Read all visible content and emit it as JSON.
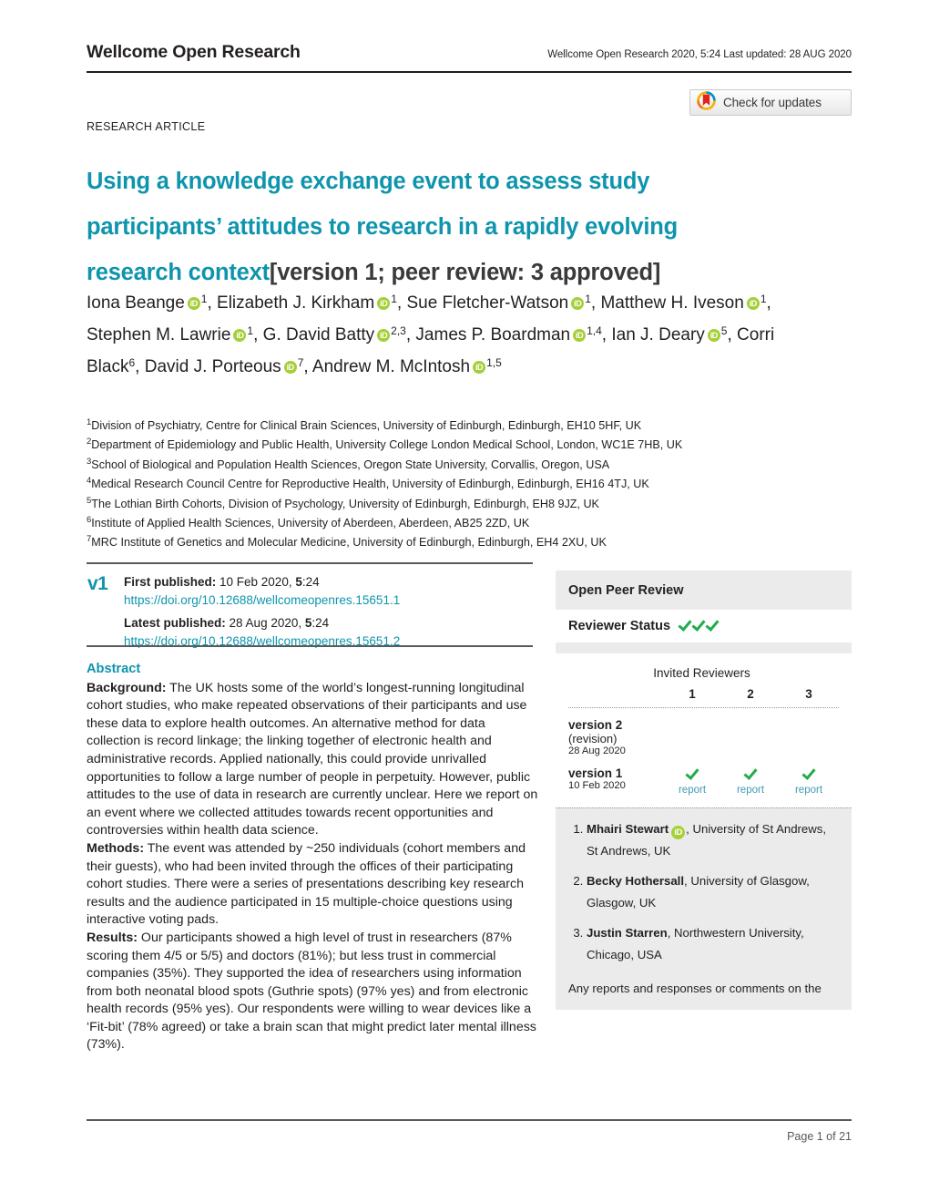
{
  "running_head": {
    "journal": "Wellcome Open Research",
    "citation": "Wellcome Open Research 2020, 5:24 Last updated: 28 AUG 2020"
  },
  "crossmark": {
    "label": "Check for updates",
    "icon": "crossmark-icon"
  },
  "article": {
    "type": "RESEARCH ARTICLE",
    "title_main": "Using a knowledge exchange event to assess study participants’ attitudes to research in a rapidly evolving research context",
    "title_version": "[version 1; peer review: 3 approved]",
    "title_color": "#0e95ad"
  },
  "authors": [
    {
      "name": "Iona Beange",
      "orcid": true,
      "affil": "1",
      "sep": ", "
    },
    {
      "name": "Elizabeth J. Kirkham",
      "orcid": true,
      "affil": "1",
      "sep": ", "
    },
    {
      "name": "Sue Fletcher-Watson",
      "orcid": true,
      "affil": "1",
      "sep": ", "
    },
    {
      "name": "Matthew H. Iveson",
      "orcid": true,
      "affil": "1",
      "sep": ", "
    },
    {
      "name": "Stephen M. Lawrie",
      "orcid": true,
      "affil": "1",
      "sep": ", "
    },
    {
      "name": "G. David Batty",
      "orcid": true,
      "affil": "2,3",
      "sep": ", "
    },
    {
      "name": "James P. Boardman",
      "orcid": true,
      "affil": "1,4",
      "sep": ", "
    },
    {
      "name": "Ian J. Deary",
      "orcid": true,
      "affil": "5",
      "sep": ", "
    },
    {
      "name": "Corri Black",
      "orcid": false,
      "affil": "6",
      "sep": ", "
    },
    {
      "name": "David J. Porteous",
      "orcid": true,
      "affil": "7",
      "sep": ", "
    },
    {
      "name": "Andrew M. McIntosh",
      "orcid": true,
      "affil": "1,5",
      "sep": ""
    }
  ],
  "affiliations": [
    {
      "num": "1",
      "text": "Division of Psychiatry, Centre for Clinical Brain Sciences, University of Edinburgh, Edinburgh, EH10 5HF, UK"
    },
    {
      "num": "2",
      "text": "Department of Epidemiology and Public Health, University College London Medical School, London, WC1E 7HB, UK"
    },
    {
      "num": "3",
      "text": "School of Biological and Population Health Sciences, Oregon State University, Corvallis, Oregon, USA"
    },
    {
      "num": "4",
      "text": "Medical Research Council Centre for Reproductive Health, University of Edinburgh, Edinburgh, EH16 4TJ, UK"
    },
    {
      "num": "5",
      "text": "The Lothian Birth Cohorts, Division of Psychology, University of Edinburgh, Edinburgh, EH8 9JZ, UK"
    },
    {
      "num": "6",
      "text": "Institute of Applied Health Sciences, University of Aberdeen, Aberdeen, AB25 2ZD, UK"
    },
    {
      "num": "7",
      "text": "MRC Institute of Genetics and Molecular Medicine, University of Edinburgh, Edinburgh, EH4 2XU, UK"
    }
  ],
  "publication": {
    "version_tag": "v1",
    "first_published_label": "First published:",
    "first_published_value": "10 Feb 2020, ",
    "first_published_vol": "5",
    "first_published_page": ":24",
    "first_doi": "https://doi.org/10.12688/wellcomeopenres.15651.1",
    "latest_published_label": "Latest published:",
    "latest_published_value": "28 Aug 2020, ",
    "latest_published_vol": "5",
    "latest_published_page": ":24",
    "latest_doi": "https://doi.org/10.12688/wellcomeopenres.15651.2"
  },
  "abstract": {
    "heading": "Abstract",
    "sections": [
      {
        "label": "Background:",
        "body": " The UK hosts some of the world’s longest-running longitudinal cohort studies, who make repeated observations of their participants and use these data to explore health outcomes. An alternative method for data collection is record linkage; the linking together of electronic health and administrative records. Applied nationally, this could provide unrivalled opportunities to follow a large number of people in perpetuity. However, public attitudes to the use of data in research are currently unclear. Here we report on an event where we collected attitudes towards recent opportunities and controversies within health data science."
      },
      {
        "label": "Methods:",
        "body": " The event was attended by ~250 individuals (cohort members and their guests), who had been invited through the offices of their participating cohort studies. There were a series of presentations describing key research results and the audience participated in 15 multiple-choice questions using interactive voting pads."
      },
      {
        "label": "Results:",
        "body": " Our participants showed a high level of trust in researchers (87% scoring them 4/5 or 5/5) and doctors (81%); but less trust in commercial companies (35%). They supported the idea of researchers using information from both neonatal blood spots (Guthrie spots) (97% yes) and from electronic health records (95% yes). Our respondents were willing to wear devices like a ‘Fit-bit’ (78% agreed) or take a brain scan that might predict later mental illness (73%)."
      }
    ]
  },
  "open_peer_review": {
    "title": "Open Peer Review",
    "status_label": "Reviewer Status",
    "status_ticks": 3,
    "invited_reviewers_label": "Invited Reviewers",
    "reviewer_columns": [
      "1",
      "2",
      "3"
    ],
    "versions": [
      {
        "name": "version 2",
        "sub": "(revision)",
        "date": "28 Aug 2020",
        "cells": [
          {
            "tick": false,
            "report": ""
          },
          {
            "tick": false,
            "report": ""
          },
          {
            "tick": false,
            "report": ""
          }
        ]
      },
      {
        "name": "version 1",
        "sub": "",
        "date": "10 Feb 2020",
        "cells": [
          {
            "tick": true,
            "report": "report"
          },
          {
            "tick": true,
            "report": "report"
          },
          {
            "tick": true,
            "report": "report"
          }
        ]
      }
    ],
    "reviewers": [
      {
        "name": "Mhairi Stewart",
        "orcid": true,
        "affiliation": ", University of St Andrews, St Andrews, UK"
      },
      {
        "name": "Becky Hothersall",
        "orcid": false,
        "affiliation": ", University of Glasgow, Glasgow, UK"
      },
      {
        "name": "Justin Starren",
        "orcid": false,
        "affiliation": ", Northwestern University, Chicago, USA"
      }
    ],
    "note": "Any reports and responses or comments on the"
  },
  "footer": {
    "page_label": "Page 1 of 21"
  }
}
